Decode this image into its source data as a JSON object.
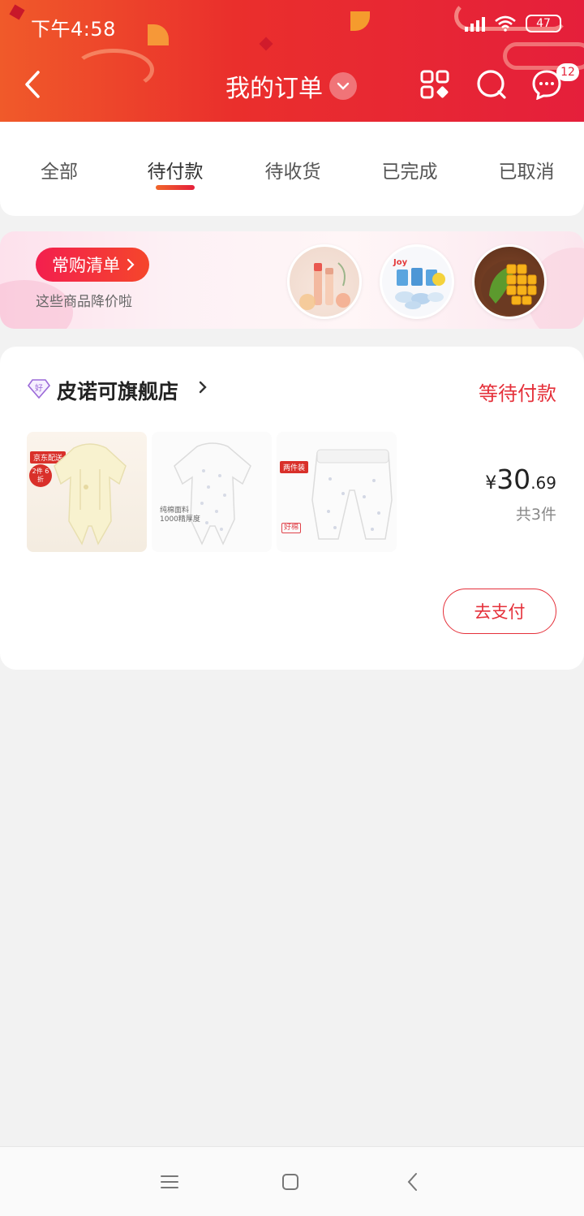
{
  "status_bar": {
    "time": "下午4:58",
    "battery": "47"
  },
  "header": {
    "title": "我的订单",
    "message_badge": "12"
  },
  "tabs": [
    {
      "label": "全部",
      "active": false
    },
    {
      "label": "待付款",
      "active": true
    },
    {
      "label": "待收货",
      "active": false
    },
    {
      "label": "已完成",
      "active": false
    },
    {
      "label": "已取消",
      "active": false
    }
  ],
  "banner": {
    "button_label": "常购清单",
    "subtitle": "这些商品降价啦",
    "thumbnails": [
      "lipstick-product",
      "candy-product",
      "mango-product"
    ]
  },
  "order": {
    "shop_badge": "好",
    "shop_name": "皮诺可旗舰店",
    "status": "等待付款",
    "price_symbol": "¥",
    "price_integer": "30",
    "price_decimal": ".69",
    "item_count": "共3件",
    "pay_button": "去支付",
    "products": [
      {
        "tags": [
          "京东配送",
          "2件 6折"
        ],
        "icon": "baby-romper-yellow"
      },
      {
        "caption": "纯棉面料 1000精厚度",
        "icon": "baby-romper-white"
      },
      {
        "tags": [
          "两件装"
        ],
        "caption": "好棉",
        "icon": "baby-pants-white"
      }
    ]
  },
  "colors": {
    "brand_red": "#e5253b",
    "accent_orange": "#f05a2a",
    "status_red": "#e5303a"
  }
}
